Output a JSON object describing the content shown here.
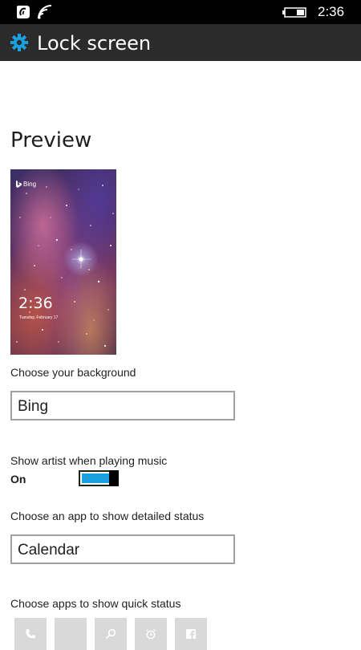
{
  "status_bar": {
    "time": "2:36"
  },
  "header": {
    "title": "Lock screen",
    "icon": "gear-icon",
    "accent": "#1ba1e2"
  },
  "preview": {
    "heading": "Preview",
    "brand": "Bing",
    "time": "2:36",
    "date": "Tuesday, February 17"
  },
  "background": {
    "label": "Choose your background",
    "value": "Bing"
  },
  "artist": {
    "label": "Show artist when playing music",
    "state": "On",
    "toggle_on": true
  },
  "detailed_status": {
    "label": "Choose an app to show detailed status",
    "value": "Calendar"
  },
  "quick_status": {
    "label": "Choose apps to show quick status",
    "slots": [
      {
        "icon": "phone-icon"
      },
      {
        "icon": "empty"
      },
      {
        "icon": "search-icon"
      },
      {
        "icon": "alarm-icon"
      },
      {
        "icon": "facebook-icon"
      }
    ]
  }
}
